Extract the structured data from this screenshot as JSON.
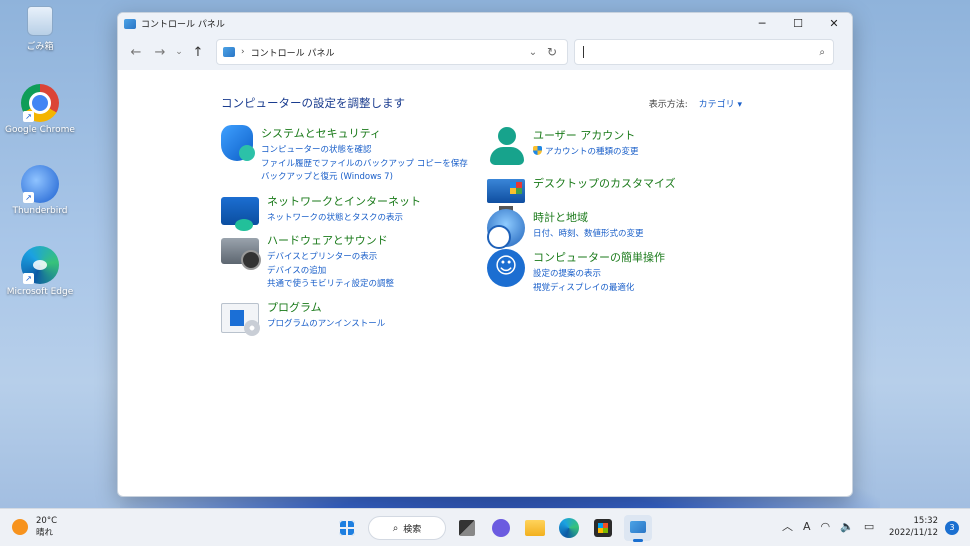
{
  "desktop": {
    "icons": [
      {
        "label": "ごみ箱",
        "icon": "recycle-bin-icon"
      },
      {
        "label": "Google Chrome",
        "icon": "chrome-icon"
      },
      {
        "label": "Thunderbird",
        "icon": "thunderbird-icon"
      },
      {
        "label": "Microsoft Edge",
        "icon": "edge-icon"
      }
    ]
  },
  "window": {
    "title": "コントロール パネル",
    "controls": {
      "minimize": "─",
      "maximize": "☐",
      "close": "✕"
    },
    "nav": {
      "back": "←",
      "forward": "→",
      "recent": "⌄",
      "up": "↑"
    },
    "address": {
      "separator": "›",
      "path": "コントロール パネル",
      "dropdown": "⌄",
      "refresh": "↻"
    },
    "search": {
      "value": "",
      "placeholder": "",
      "icon": "⌕"
    },
    "heading": "コンピューターの設定を調整します",
    "view_by": {
      "label": "表示方法:",
      "value": "カテゴリ ▾"
    },
    "categories_left": [
      {
        "title": "システムとセキュリティ",
        "links": [
          "コンピューターの状態を確認",
          "ファイル履歴でファイルのバックアップ コピーを保存",
          "バックアップと復元 (Windows 7)"
        ]
      },
      {
        "title": "ネットワークとインターネット",
        "links": [
          "ネットワークの状態とタスクの表示"
        ]
      },
      {
        "title": "ハードウェアとサウンド",
        "links": [
          "デバイスとプリンターの表示",
          "デバイスの追加",
          "共通で使うモビリティ設定の調整"
        ]
      },
      {
        "title": "プログラム",
        "links": [
          "プログラムのアンインストール"
        ]
      }
    ],
    "categories_right": [
      {
        "title": "ユーザー アカウント",
        "links": [
          "アカウントの種類の変更"
        ]
      },
      {
        "title": "デスクトップのカスタマイズ",
        "links": []
      },
      {
        "title": "時計と地域",
        "links": [
          "日付、時刻、数値形式の変更"
        ]
      },
      {
        "title": "コンピューターの簡単操作",
        "links": [
          "設定の提案の表示",
          "視覚ディスプレイの最適化"
        ]
      }
    ]
  },
  "taskbar": {
    "weather": {
      "temp": "20°C",
      "condition": "晴れ"
    },
    "search_label": "検索",
    "search_icon": "⌕",
    "tray": {
      "chevron": "︿",
      "ime": "A",
      "wifi": "◠",
      "volume": "🔈",
      "battery": "▭"
    },
    "time": "15:32",
    "date": "2022/11/12",
    "notifications": "3"
  },
  "colors": {
    "accent": "#1a5fc9",
    "category_title": "#1a7a1a",
    "heading": "#1a3c8f"
  }
}
